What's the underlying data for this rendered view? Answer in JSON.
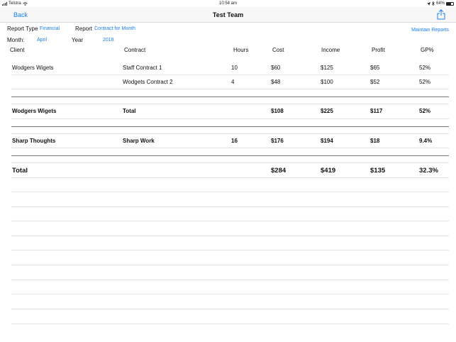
{
  "status": {
    "carrier": "Telstra",
    "time": "10:54 am",
    "battery": "64%",
    "battery_level": 0.64
  },
  "nav": {
    "back_label": "Back",
    "title": "Test Team"
  },
  "filters": {
    "report_type_label": "Report Type",
    "report_type_value": "Financial",
    "report_label": "Report",
    "report_value": "Contract for Month",
    "maintain_label": "Maintain Reports",
    "month_label": "Month:",
    "month_value": "April",
    "year_label": "Year",
    "year_value": "2018"
  },
  "table": {
    "headers": {
      "client": "Client",
      "contract": "Contract",
      "hours": "Hours",
      "cost": "Cost",
      "income": "Income",
      "profit": "Profit",
      "gp": "GP%"
    },
    "rows": [
      {
        "client": "Wodgers Wigets",
        "contract": "Staff Contract 1",
        "hours": "10",
        "cost": "$60",
        "income": "$125",
        "profit": "$65",
        "gp": "52%"
      },
      {
        "client": "",
        "contract": "Wodgets Contract 2",
        "hours": "4",
        "cost": "$48",
        "income": "$100",
        "profit": "$52",
        "gp": "52%"
      },
      {
        "client": "Wodgers Wigets",
        "contract": "Total",
        "hours": "",
        "cost": "$108",
        "income": "$225",
        "profit": "$117",
        "gp": "52%"
      },
      {
        "client": "Sharp Thoughts",
        "contract": "Sharp Work",
        "hours": "16",
        "cost": "$176",
        "income": "$194",
        "profit": "$18",
        "gp": "9.4%"
      },
      {
        "client": "Total",
        "contract": "",
        "hours": "",
        "cost": "$284",
        "income": "$419",
        "profit": "$135",
        "gp": "32.3%"
      }
    ]
  }
}
